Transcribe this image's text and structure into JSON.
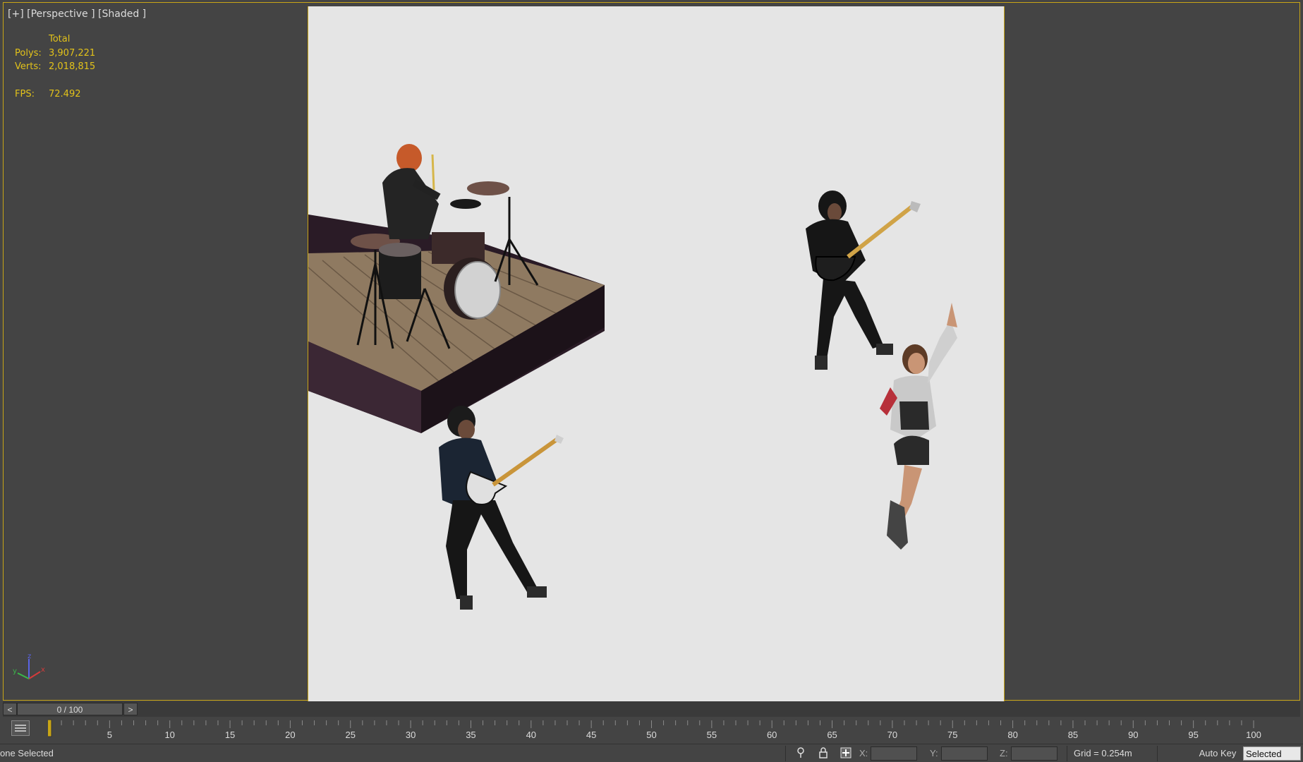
{
  "viewport": {
    "label_plus": "[+]",
    "label_view": "[Perspective ]",
    "label_shading": "[Shaded ]"
  },
  "stats": {
    "header": "Total",
    "polys_label": "Polys:",
    "polys_value": "3,907,221",
    "verts_label": "Verts:",
    "verts_value": "2,018,815",
    "fps_label": "FPS:",
    "fps_value": "72.492"
  },
  "axis_gizmo": {
    "x": "x",
    "y": "y",
    "z": "z"
  },
  "timeslider": {
    "prev": "<",
    "frame": "0 / 100",
    "next": ">"
  },
  "trackbar": {
    "current_frame": 0,
    "ticks": [
      "5",
      "10",
      "15",
      "20",
      "25",
      "30",
      "35",
      "40",
      "45",
      "50",
      "55",
      "60",
      "65",
      "70",
      "75",
      "80",
      "85",
      "90",
      "95",
      "100"
    ]
  },
  "statusbar": {
    "selection": "one Selected",
    "x_label": "X:",
    "y_label": "Y:",
    "z_label": "Z:",
    "grid": "Grid = 0.254m",
    "auto_key": "Auto Key",
    "key_filter": "Selected"
  },
  "icons": {
    "isolate": "pin-icon",
    "lock": "lock-icon",
    "absolute": "transform-mode-icon",
    "trackbar": "curve-editor-icon"
  },
  "colors": {
    "accent": "#c8a516",
    "stats": "#e2c21a",
    "background": "#444444",
    "safe_frame": "#e5e5e5"
  }
}
